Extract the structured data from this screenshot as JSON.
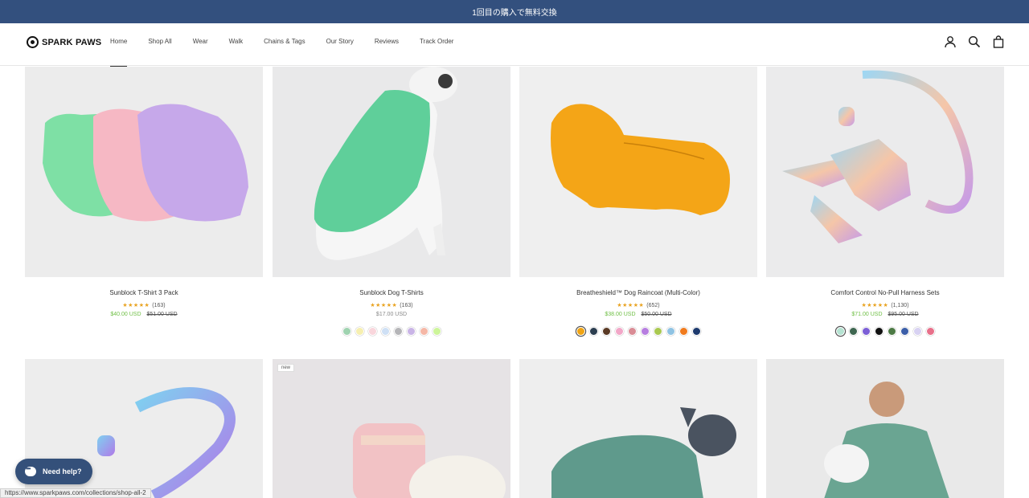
{
  "announcement": {
    "text": "1回目の購入で無料交換"
  },
  "header": {
    "brand": "SPARK PAWS",
    "nav": [
      {
        "label": "Home",
        "active": true
      },
      {
        "label": "Shop All"
      },
      {
        "label": "Wear"
      },
      {
        "label": "Walk"
      },
      {
        "label": "Chains & Tags"
      },
      {
        "label": "Our Story"
      },
      {
        "label": "Reviews"
      },
      {
        "label": "Track Order"
      }
    ],
    "icons": [
      "account-icon",
      "search-icon",
      "cart-icon"
    ]
  },
  "products": [
    {
      "title": "Sunblock T-Shirt 3 Pack",
      "stars": "★★★★★",
      "reviews": "(163)",
      "price": "$40.00 USD",
      "compare_price": "$51.00 USD",
      "swatches": []
    },
    {
      "title": "Sunblock Dog T-Shirts",
      "stars": "★★★★★",
      "reviews": "(163)",
      "price": "$17.00 USD",
      "compare_price": "",
      "swatches": [
        "#9fd3b0",
        "#f6efb0",
        "#f9d6dc",
        "#cfe0f5",
        "#b5b5b8",
        "#c9b4e6",
        "#f5b7a6",
        "#cdf59a"
      ]
    },
    {
      "title": "Breatheshield™ Dog Raincoat (Multi-Color)",
      "stars": "★★★★★",
      "reviews": "(652)",
      "price": "$38.00 USD",
      "compare_price": "$50.00 USD",
      "swatches": [
        "#f0a413",
        "#2c3e50",
        "#5a3a25",
        "#f2a7c8",
        "#d98c95",
        "#b77ee0",
        "#a9c950",
        "#8fc3e3",
        "#f07b1e",
        "#1e3a6e"
      ]
    },
    {
      "title": "Comfort Control No-Pull Harness Sets",
      "stars": "★★★★★",
      "reviews": "(1,130)",
      "price": "$71.00 USD",
      "compare_price": "$95.00 USD",
      "swatches": [
        "#b5e3d2",
        "#3e6650",
        "#7c5fd6",
        "#111111",
        "#4d7a45",
        "#3b5ea8",
        "#d8d2f2",
        "#e8708a"
      ]
    }
  ],
  "row2": [
    {
      "badge": ""
    },
    {
      "badge": "new"
    },
    {
      "badge": ""
    },
    {
      "badge": ""
    }
  ],
  "help": {
    "label": "Need help?"
  },
  "status_bar": {
    "url": "https://www.sparkpaws.com/collections/shop-all-2"
  }
}
